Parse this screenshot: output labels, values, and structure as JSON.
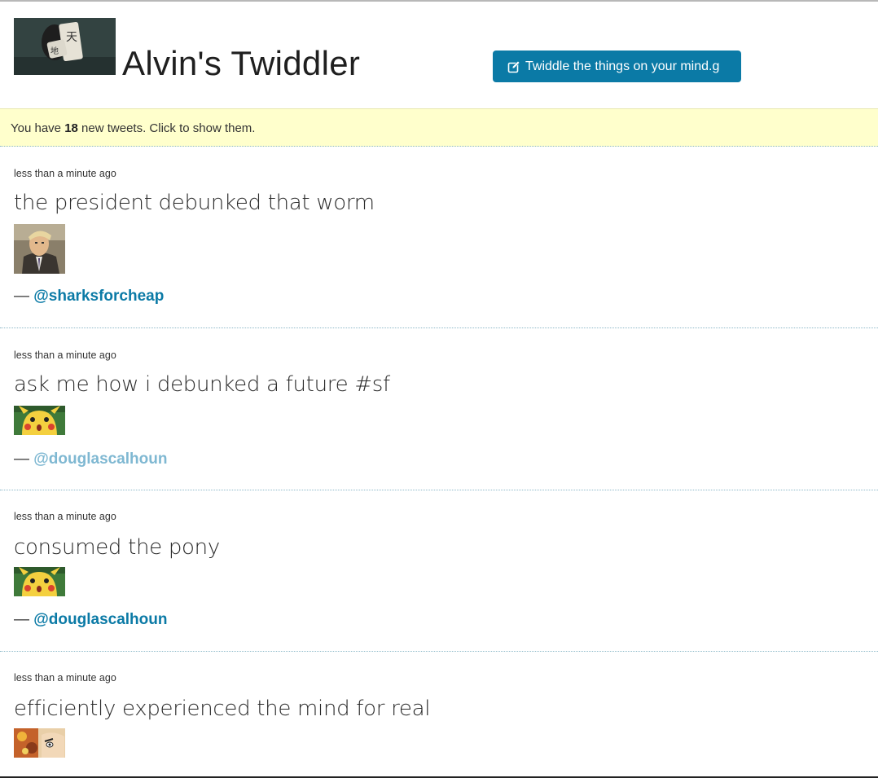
{
  "app": {
    "title": "Alvin's Twiddler",
    "compose_label": "Twiddle the things on your mind.g"
  },
  "banner": {
    "prefix": "You have ",
    "count": "18",
    "suffix": " new tweets. Click to show them."
  },
  "colors": {
    "accent": "#0b7aa6",
    "banner_bg": "#ffffcc"
  },
  "tweets": [
    {
      "time": "less than a minute ago",
      "text": "the president debunked that worm",
      "author": "@sharksforcheap",
      "avatar": "suited-man-avatar"
    },
    {
      "time": "less than a minute ago",
      "text": "ask me how i debunked a future #sf",
      "author": "@douglascalhoun",
      "avatar": "surprised-pikachu-avatar"
    },
    {
      "time": "less than a minute ago",
      "text": "consumed the pony",
      "author": "@douglascalhoun",
      "avatar": "surprised-pikachu-avatar"
    },
    {
      "time": "less than a minute ago",
      "text": "efficiently experienced the mind for real",
      "author": "",
      "avatar": "cartoon-face-avatar"
    }
  ]
}
